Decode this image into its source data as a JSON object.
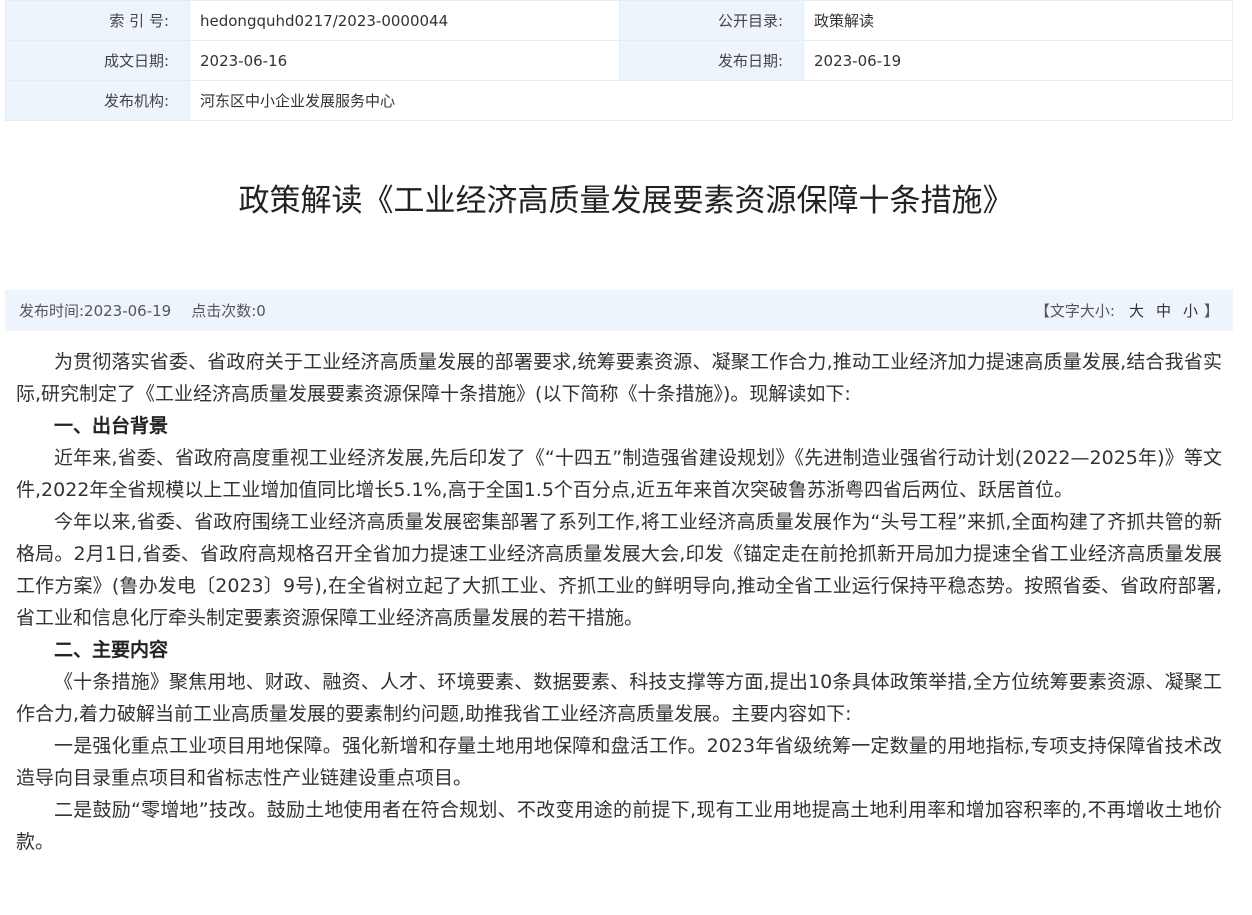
{
  "meta": {
    "index_label": "索 引 号:",
    "index_value": "hedongquhd0217/2023-0000044",
    "catalog_label": "公开目录:",
    "catalog_value": "政策解读",
    "written_label": "成文日期:",
    "written_value": "2023-06-16",
    "publish_label": "发布日期:",
    "publish_value": "2023-06-19",
    "org_label": "发布机构:",
    "org_value": "河东区中小企业发展服务中心"
  },
  "title": "政策解读《工业经济高质量发展要素资源保障十条措施》",
  "infobar": {
    "publish_time": "发布时间:2023-06-19",
    "clicks": "点击次数:0",
    "font_size_label": "【文字大小:",
    "size_large": "大",
    "size_medium": "中",
    "size_small": "小",
    "font_size_close": "】"
  },
  "content": {
    "p1": "为贯彻落实省委、省政府关于工业经济高质量发展的部署要求,统筹要素资源、凝聚工作合力,推动工业经济加力提速高质量发展,结合我省实际,研究制定了《工业经济高质量发展要素资源保障十条措施》(以下简称《十条措施》)。现解读如下:",
    "h1": "一、出台背景",
    "p2": "近年来,省委、省政府高度重视工业经济发展,先后印发了《“十四五”制造强省建设规划》《先进制造业强省行动计划(2022—2025年)》等文件,2022年全省规模以上工业增加值同比增长5.1%,高于全国1.5个百分点,近五年来首次突破鲁苏浙粤四省后两位、跃居首位。",
    "p3": "今年以来,省委、省政府围绕工业经济高质量发展密集部署了系列工作,将工业经济高质量发展作为“头号工程”来抓,全面构建了齐抓共管的新格局。2月1日,省委、省政府高规格召开全省加力提速工业经济高质量发展大会,印发《锚定走在前抢抓新开局加力提速全省工业经济高质量发展工作方案》(鲁办发电〔2023〕9号),在全省树立起了大抓工业、齐抓工业的鲜明导向,推动全省工业运行保持平稳态势。按照省委、省政府部署,省工业和信息化厅牵头制定要素资源保障工业经济高质量发展的若干措施。",
    "h2": "二、主要内容",
    "p4": "《十条措施》聚焦用地、财政、融资、人才、环境要素、数据要素、科技支撑等方面,提出10条具体政策举措,全方位统筹要素资源、凝聚工作合力,着力破解当前工业高质量发展的要素制约问题,助推我省工业经济高质量发展。主要内容如下:",
    "p5": "一是强化重点工业项目用地保障。强化新增和存量土地用地保障和盘活工作。2023年省级统筹一定数量的用地指标,专项支持保障省技术改造导向目录重点项目和省标志性产业链建设重点项目。",
    "p6": "二是鼓励“零增地”技改。鼓励土地使用者在符合规划、不改变用途的前提下,现有工业用地提高土地利用率和增加容积率的,不再增收土地价款。"
  }
}
